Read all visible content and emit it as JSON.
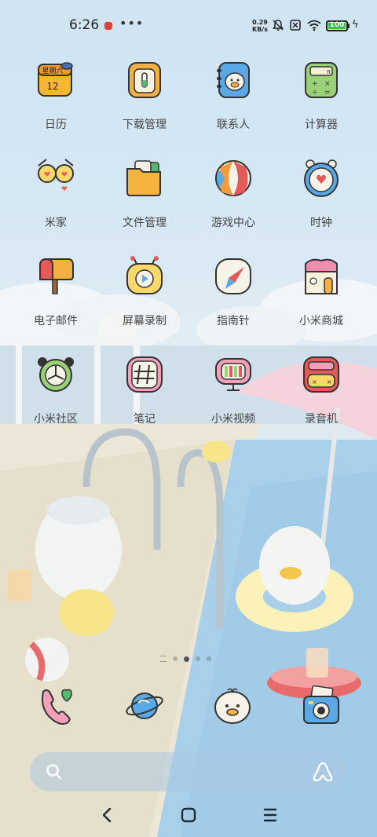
{
  "status_bar": {
    "time": "6:26",
    "net_speed_value": "0.29",
    "net_speed_unit": "KB/s",
    "battery_level": "100",
    "icons": [
      "notification-dot-icon",
      "more-icon",
      "bell-muted-icon",
      "sim-off-icon",
      "wifi-icon",
      "battery-icon",
      "charging-icon"
    ]
  },
  "apps": [
    {
      "label": "日历",
      "icon": "calendar-icon",
      "weekday": "星期六",
      "day": "12"
    },
    {
      "label": "下载管理",
      "icon": "download-manager-icon"
    },
    {
      "label": "联系人",
      "icon": "contacts-icon"
    },
    {
      "label": "计算器",
      "icon": "calculator-icon"
    },
    {
      "label": "米家",
      "icon": "mi-home-icon"
    },
    {
      "label": "文件管理",
      "icon": "file-manager-icon"
    },
    {
      "label": "游戏中心",
      "icon": "game-center-icon"
    },
    {
      "label": "时钟",
      "icon": "clock-icon"
    },
    {
      "label": "电子邮件",
      "icon": "email-icon"
    },
    {
      "label": "屏幕录制",
      "icon": "screen-recorder-icon"
    },
    {
      "label": "指南针",
      "icon": "compass-icon"
    },
    {
      "label": "小米商城",
      "icon": "mi-store-icon"
    },
    {
      "label": "小米社区",
      "icon": "mi-community-icon"
    },
    {
      "label": "笔记",
      "icon": "notes-icon"
    },
    {
      "label": "小米视频",
      "icon": "mi-video-icon"
    },
    {
      "label": "录音机",
      "icon": "recorder-icon"
    }
  ],
  "page_indicator": {
    "pages": 5,
    "active": 3
  },
  "dock": [
    "phone-icon",
    "browser-icon",
    "messages-icon",
    "camera-icon"
  ],
  "colors": {
    "accent": "#f5a623",
    "dark": "#3a3f4a",
    "battery": "#37c837"
  }
}
